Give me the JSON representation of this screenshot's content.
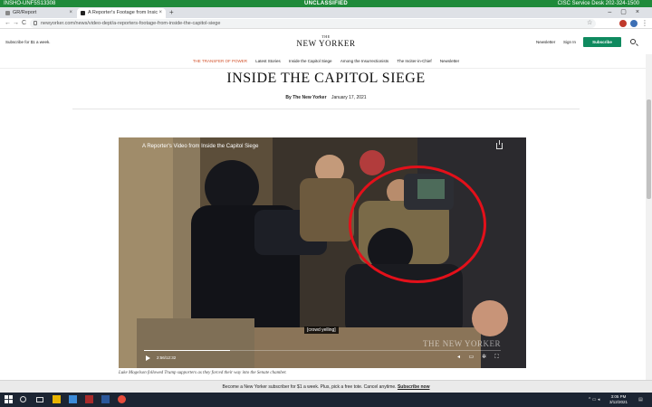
{
  "classification": {
    "left": "INSHO-UNF5S13308",
    "center": "UNCLASSIFIED",
    "right": "CISC Service Desk 202-324-1500"
  },
  "browser": {
    "tabs": [
      {
        "label": "GR/Report"
      },
      {
        "label": "A Reporter's Footage from Insic"
      }
    ],
    "new_tab": "+",
    "address": "newyorker.com/news/video-dept/a-reporters-footage-from-inside-the-capitol-siege",
    "back": "←",
    "forward": "→",
    "reload": "C"
  },
  "site": {
    "promo_left": "Subscribe for $1 a week.",
    "logo_the": "THE",
    "logo_name": "NEW YORKER",
    "newsletter_link": "Newsletter",
    "signin_link": "Sign In",
    "subscribe_button": "Subscribe",
    "nav": [
      "THE TRANSFER OF POWER",
      "Latest Stories",
      "Inside the Capitol Siege",
      "Among the Insurrectionists",
      "The Inciter-in-Chief",
      "Newsletter"
    ]
  },
  "article": {
    "headline": "INSIDE THE CAPITOL SIEGE",
    "byline_author": "By The New Yorker",
    "byline_date": "January 17, 2021",
    "video_title": "A Reporter's Video from Inside the Capitol Siege",
    "cc_text": "[crowd yelling]",
    "watermark": "THE NEW YORKER",
    "timecode": "2:56/12:32",
    "progress": 0.24,
    "caption": "Luke Mogelson followed Trump supporters as they forced their way into the Senate chamber."
  },
  "promo_bar": {
    "text": "Become a New Yorker subscriber for $1 a week. Plus, pick a free tote. Cancel anytime.",
    "link": "Subscribe now"
  },
  "taskbar": {
    "time": "3:05 PM",
    "date": "3/12/2021"
  },
  "colors": {
    "classification": "#1f8a3a",
    "subscribe": "#0f8a5f",
    "nav_accent": "#d2522b",
    "annotation_circle": "#e3101a",
    "taskbar": "#1c2533"
  }
}
